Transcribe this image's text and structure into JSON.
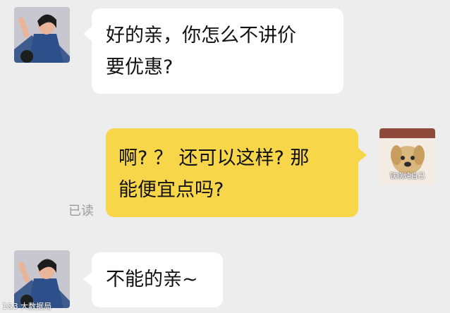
{
  "messages": [
    {
      "side": "left",
      "text": "好的亲，你怎么不讲价要优惠?",
      "line1": "好的亲，你怎么不讲价",
      "line2": "要优惠?"
    },
    {
      "side": "right",
      "text": "啊？？还可以这样？那能便宜点吗?",
      "line1": "啊? ？ 还可以这样? 那",
      "line2": "能便宜点吗?",
      "read_receipt": "已读"
    },
    {
      "side": "left",
      "text": "不能的亲~"
    }
  ],
  "avatars": {
    "contact": {
      "icon": "woman-portrait-avatar"
    },
    "self": {
      "icon": "dog-avatar",
      "caption": "铁锅炖自己"
    }
  },
  "watermark": "1&3 大数据局"
}
